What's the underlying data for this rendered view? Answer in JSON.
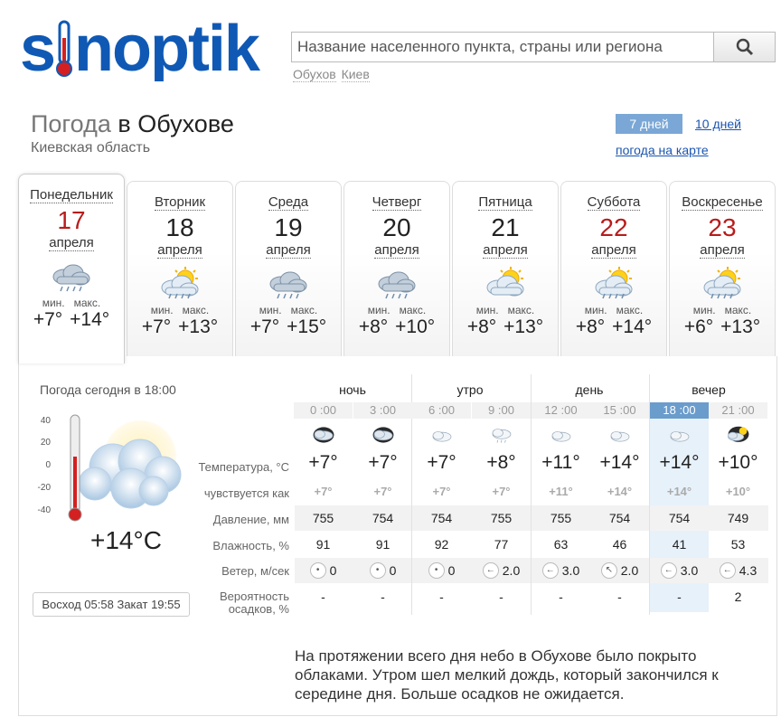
{
  "logo": {
    "text": "sinoptik"
  },
  "search": {
    "placeholder": "Название населенного пункта, страны или региона",
    "value": "",
    "recent": [
      "Обухов",
      "Киев"
    ]
  },
  "header": {
    "title_prefix": "Погода",
    "title_rest": "в Обухове",
    "region": "Киевская область"
  },
  "range_tabs": {
    "active": "7 дней",
    "other": "10 дней",
    "map_link": "погода на карте"
  },
  "days": [
    {
      "name": "Понедельник",
      "date": "17",
      "month": "апреля",
      "min_label": "мин.",
      "max_label": "макс.",
      "min": "+7°",
      "max": "+14°",
      "icon": "cloud-rain-icon",
      "weekend": true
    },
    {
      "name": "Вторник",
      "date": "18",
      "month": "апреля",
      "min_label": "мин.",
      "max_label": "макс.",
      "min": "+7°",
      "max": "+13°",
      "icon": "sun-cloud-rain-icon",
      "weekend": false
    },
    {
      "name": "Среда",
      "date": "19",
      "month": "апреля",
      "min_label": "мин.",
      "max_label": "макс.",
      "min": "+7°",
      "max": "+15°",
      "icon": "cloud-rain-icon",
      "weekend": false
    },
    {
      "name": "Четверг",
      "date": "20",
      "month": "апреля",
      "min_label": "мин.",
      "max_label": "макс.",
      "min": "+8°",
      "max": "+10°",
      "icon": "cloud-rain-icon",
      "weekend": false
    },
    {
      "name": "Пятница",
      "date": "21",
      "month": "апреля",
      "min_label": "мин.",
      "max_label": "макс.",
      "min": "+8°",
      "max": "+13°",
      "icon": "sun-cloud-icon",
      "weekend": false
    },
    {
      "name": "Суббота",
      "date": "22",
      "month": "апреля",
      "min_label": "мин.",
      "max_label": "макс.",
      "min": "+8°",
      "max": "+14°",
      "icon": "sun-cloud-rain-icon",
      "weekend": true
    },
    {
      "name": "Воскресенье",
      "date": "23",
      "month": "апреля",
      "min_label": "мин.",
      "max_label": "макс.",
      "min": "+6°",
      "max": "+13°",
      "icon": "sun-cloud-rain-icon",
      "weekend": true
    }
  ],
  "now": {
    "label": "Погода сегодня в 18:00",
    "temp": "+14°C",
    "scale": [
      "40",
      "20",
      "0",
      "-20",
      "-40"
    ],
    "sunrise_label": "Восход",
    "sunrise": "05:58",
    "sunset_label": "Закат",
    "sunset": "19:55"
  },
  "periods": [
    "ночь",
    "утро",
    "день",
    "вечер"
  ],
  "hours": [
    "0 :00",
    "3 :00",
    "6 :00",
    "9 :00",
    "12 :00",
    "15 :00",
    "18 :00",
    "21 :00"
  ],
  "hour_icons": [
    "night-cloud-icon",
    "night-cloud-icon",
    "light-cloud-icon",
    "cloud-drizzle-icon",
    "light-cloud-icon",
    "light-cloud-icon",
    "light-cloud-icon",
    "night-moon-cloud-icon"
  ],
  "row_labels": {
    "temp": "Температура, °C",
    "feel": "чувствуется как",
    "pres": "Давление, мм",
    "hum": "Влажность, %",
    "wind": "Ветер, м/сек",
    "prec_1": "Вероятность",
    "prec_2": "осадков, %"
  },
  "temps": [
    "+7°",
    "+7°",
    "+7°",
    "+8°",
    "+11°",
    "+14°",
    "+14°",
    "+10°"
  ],
  "feels": [
    "+7°",
    "+7°",
    "+7°",
    "+7°",
    "+11°",
    "+14°",
    "+14°",
    "+10°"
  ],
  "pressure": [
    "755",
    "754",
    "754",
    "755",
    "755",
    "754",
    "754",
    "749"
  ],
  "humidity": [
    "91",
    "91",
    "92",
    "77",
    "63",
    "46",
    "41",
    "53"
  ],
  "wind": [
    "0",
    "0",
    "0",
    "2.0",
    "3.0",
    "2.0",
    "3.0",
    "4.3"
  ],
  "wind_dirs": [
    "•",
    "•",
    "•",
    "←",
    "←",
    "↖",
    "←",
    "←"
  ],
  "precip": [
    "-",
    "-",
    "-",
    "-",
    "-",
    "-",
    "-",
    "2"
  ],
  "description": "На протяжении всего дня небо в Обухове было покрыто облаками. Утром шел мелкий дождь, который закончился к середине дня. Больше осадков не ожидается."
}
